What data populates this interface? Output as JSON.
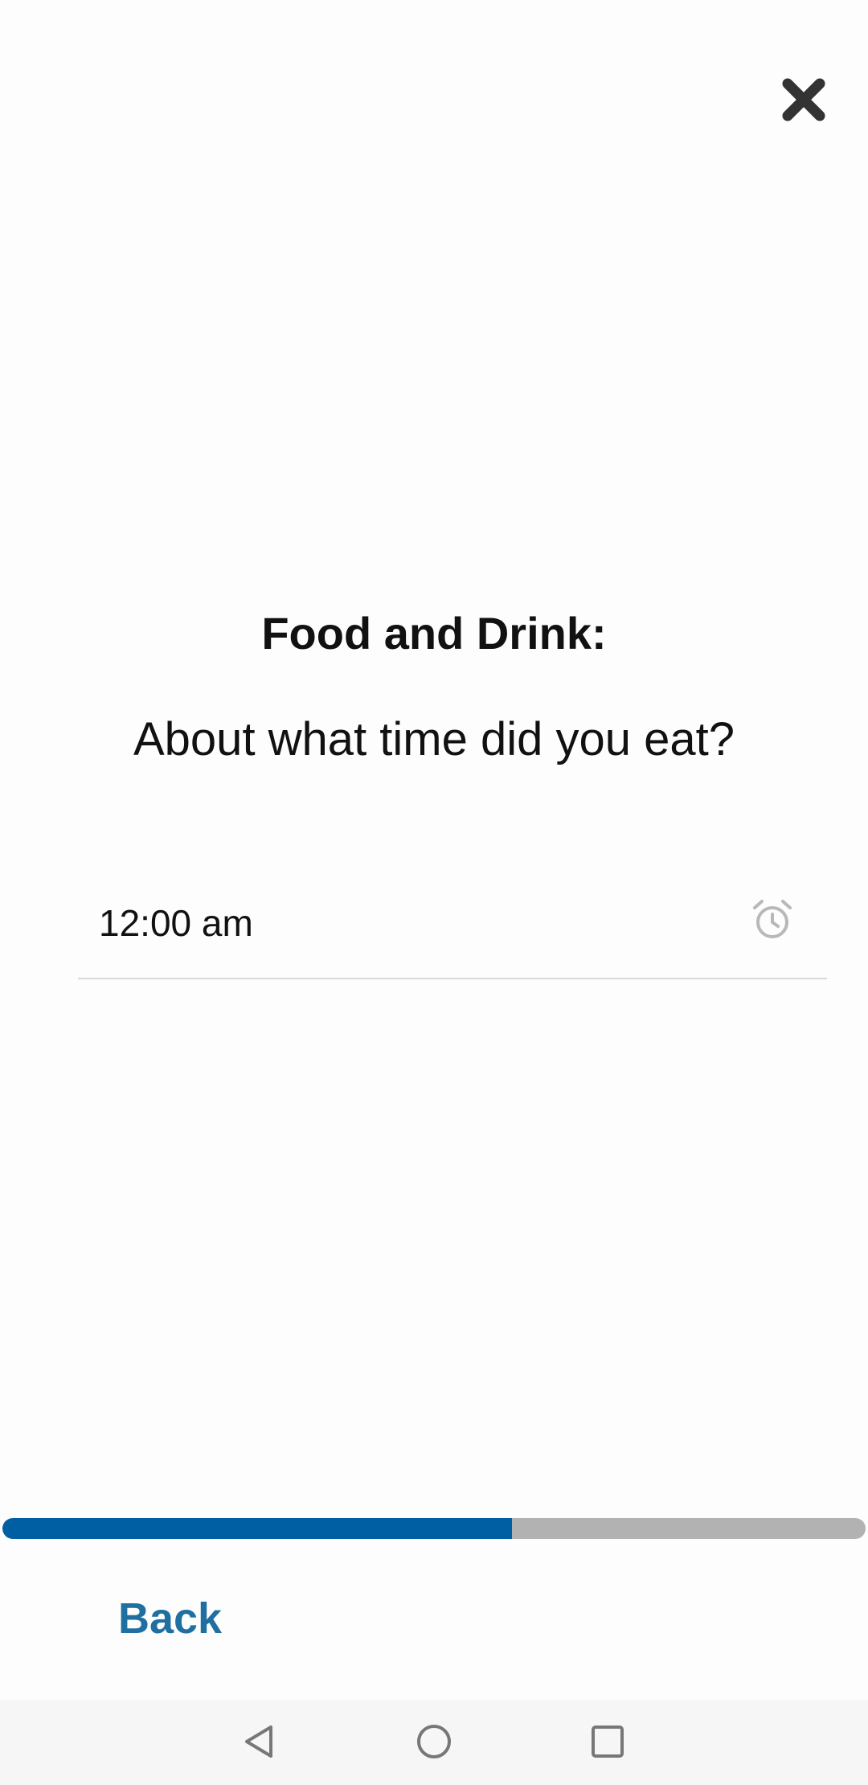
{
  "header": {
    "close_icon": "close-icon"
  },
  "main": {
    "title": "Food and Drink:",
    "question": "About what time did you eat?",
    "time_input": {
      "value": "12:00 am",
      "icon": "alarm-clock-icon"
    }
  },
  "progress": {
    "fraction": 0.59,
    "fill_color": "#005fa3",
    "track_color": "#b2b2b2"
  },
  "footer": {
    "back_label": "Back",
    "back_color": "#1f6fa0"
  },
  "system_nav": {
    "back_icon": "nav-back-icon",
    "home_icon": "nav-home-icon",
    "recents_icon": "nav-recents-icon"
  }
}
